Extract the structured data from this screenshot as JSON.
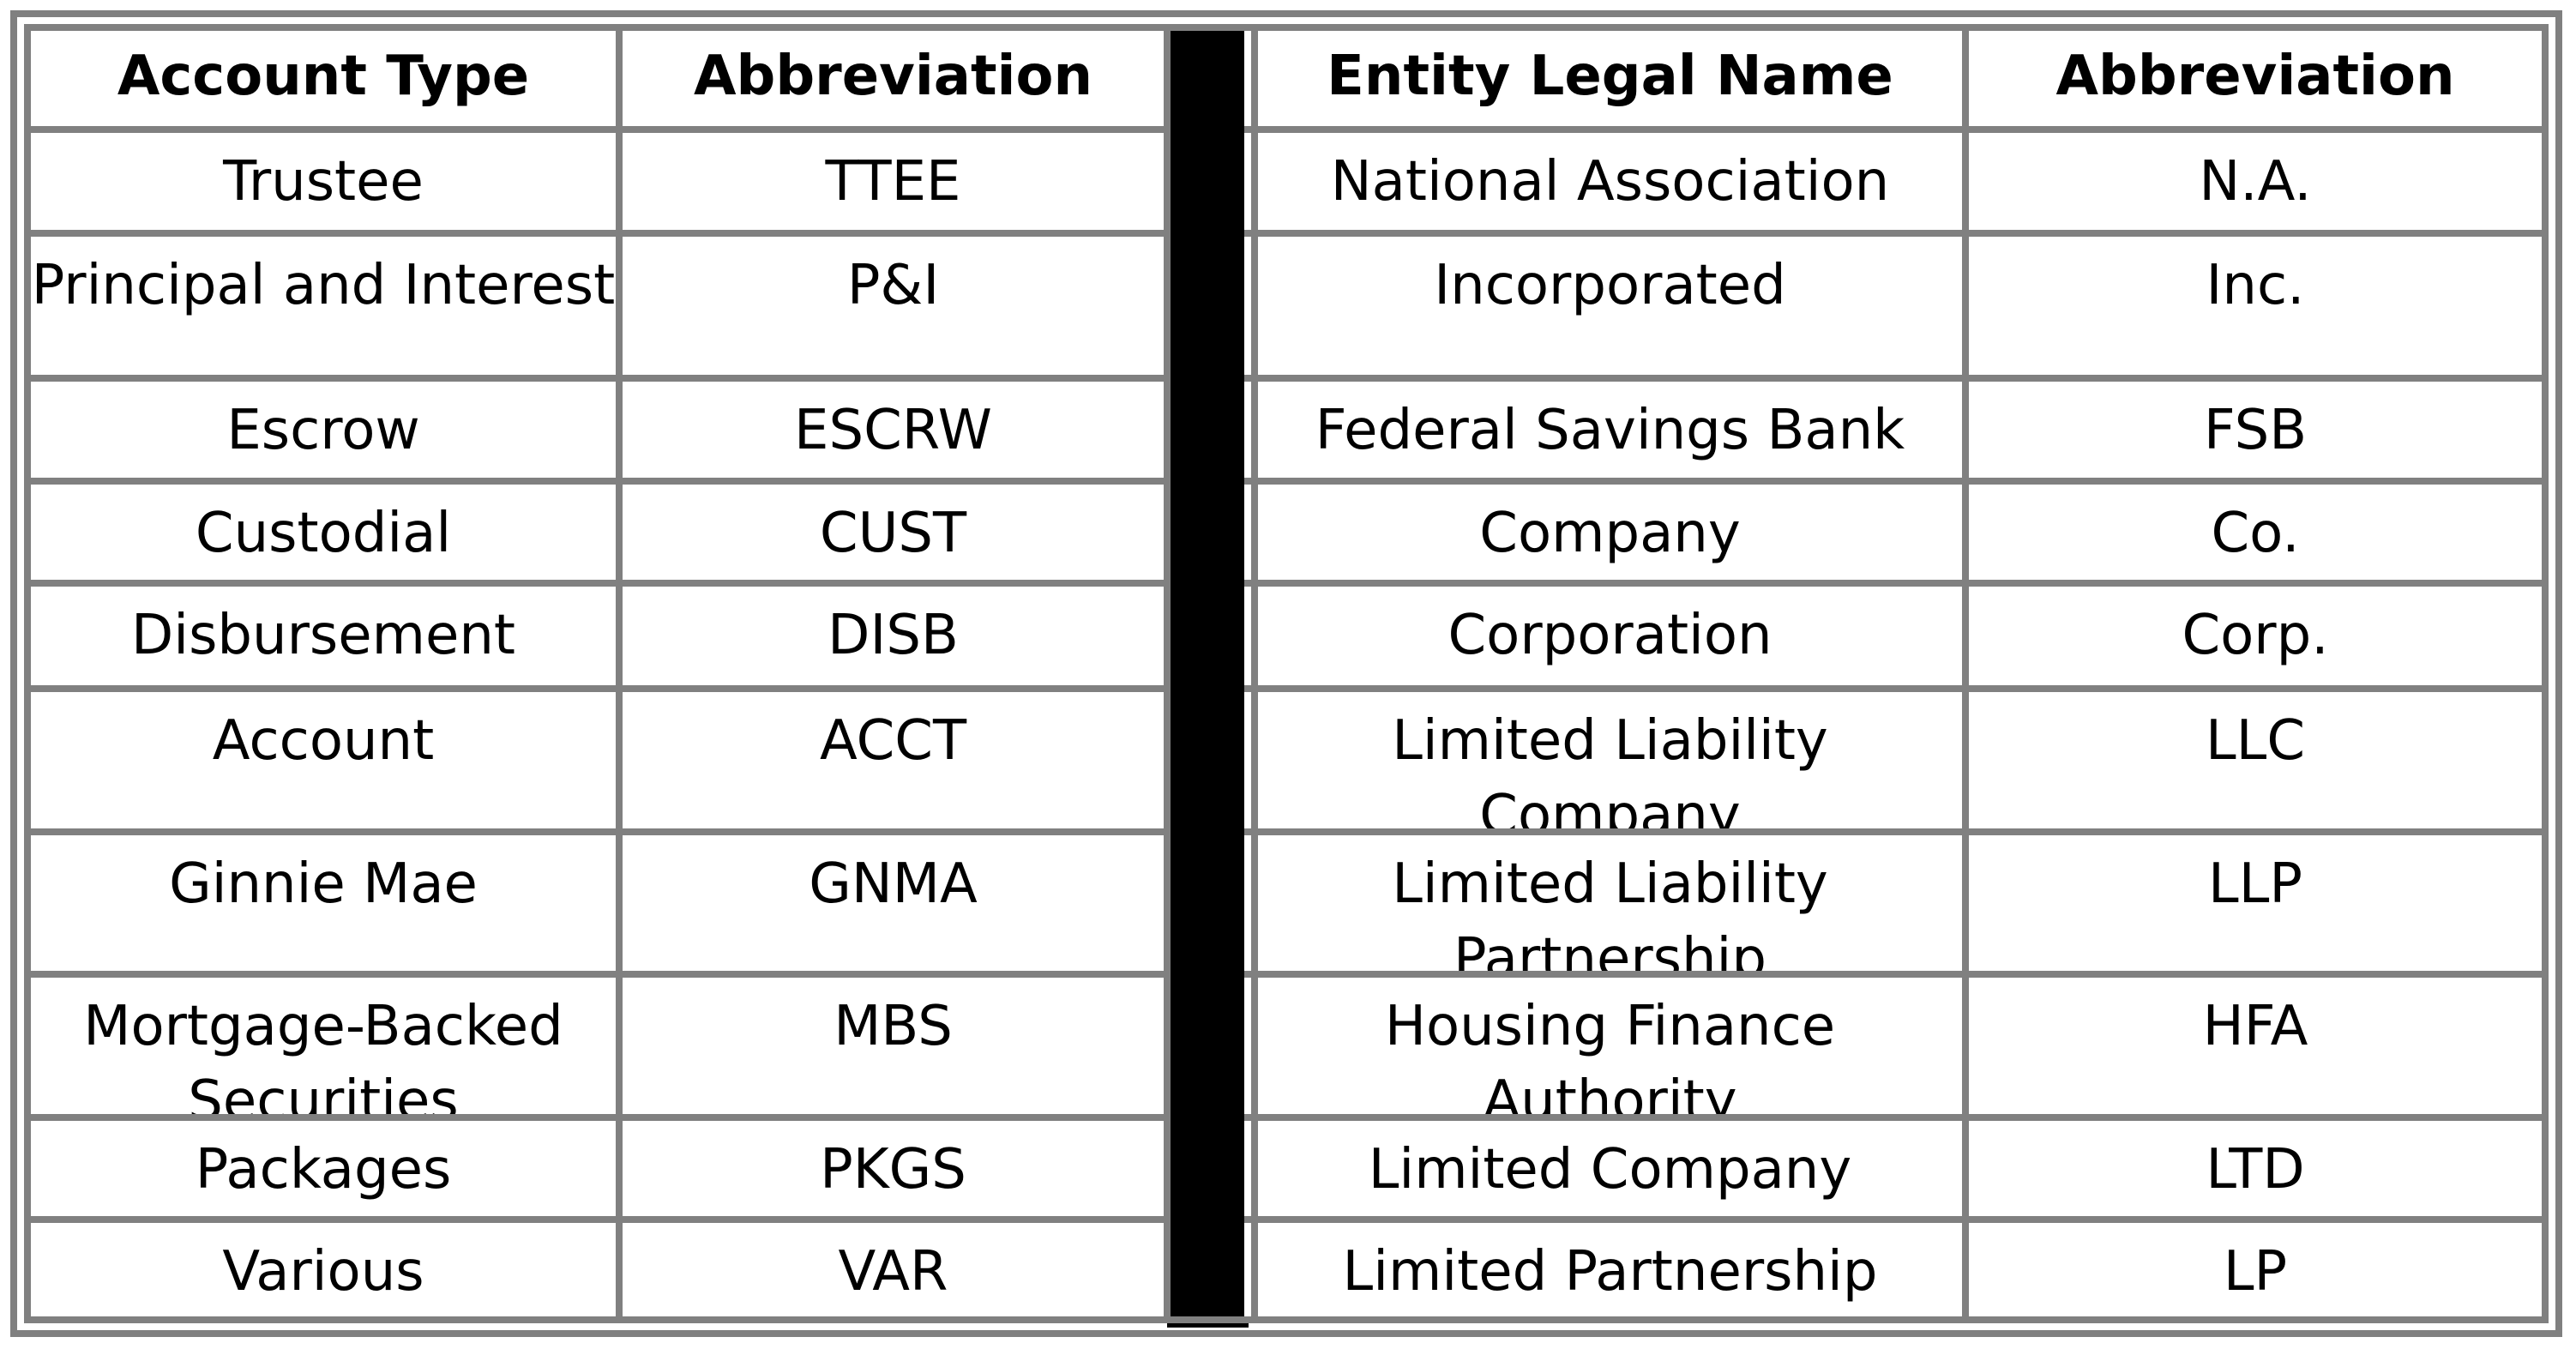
{
  "left_table": {
    "headers": [
      "Account Type",
      "Abbreviation"
    ],
    "rows": [
      [
        "Trustee",
        "TTEE"
      ],
      [
        "Principal and Interest",
        "P&I"
      ],
      [
        "Escrow",
        "ESCRW"
      ],
      [
        "Custodial",
        "CUST"
      ],
      [
        "Disbursement",
        "DISB"
      ],
      [
        "Account",
        "ACCT"
      ],
      [
        "Ginnie Mae",
        "GNMA"
      ],
      [
        "Mortgage-Backed Securities",
        "MBS"
      ],
      [
        "Packages",
        "PKGS"
      ],
      [
        "Various",
        "VAR"
      ]
    ]
  },
  "right_table": {
    "headers": [
      "Entity Legal Name",
      "Abbreviation"
    ],
    "rows": [
      [
        "National Association",
        "N.A."
      ],
      [
        "Incorporated",
        "Inc."
      ],
      [
        "Federal Savings Bank",
        "FSB"
      ],
      [
        "Company",
        "Co."
      ],
      [
        "Corporation",
        "Corp."
      ],
      [
        "Limited Liability Company",
        "LLC"
      ],
      [
        "Limited Liability Partnership",
        "LLP"
      ],
      [
        "Housing Finance Authority",
        "HFA"
      ],
      [
        "Limited Company",
        "LTD"
      ],
      [
        "Limited Partnership",
        "LP"
      ]
    ]
  },
  "colors": {
    "border": "#808080",
    "separator": "#000000",
    "text": "#000000",
    "background": "#ffffff"
  }
}
